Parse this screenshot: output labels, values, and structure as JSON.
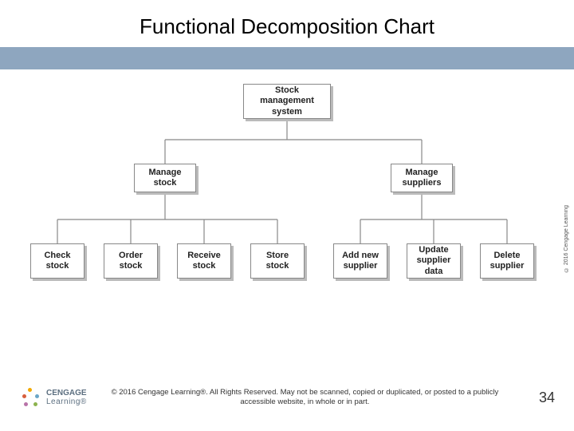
{
  "title": "Functional Decomposition Chart",
  "nodes": {
    "root": "Stock management system",
    "level2": [
      "Manage stock",
      "Manage suppliers"
    ],
    "leaves": [
      "Check stock",
      "Order stock",
      "Receive stock",
      "Store stock",
      "Add new supplier",
      "Update supplier data",
      "Delete supplier"
    ]
  },
  "side_credit": "© 2016 Cengage Learning",
  "logo": {
    "name": "CENGAGE",
    "sub": "Learning®"
  },
  "copyright": "© 2016 Cengage Learning®. All Rights Reserved. May not be scanned, copied or duplicated, or posted to a publicly accessible website, in whole or in part.",
  "page_number": "34",
  "chart_data": {
    "type": "hierarchy",
    "root": {
      "label": "Stock management system",
      "children": [
        {
          "label": "Manage stock",
          "children": [
            {
              "label": "Check stock"
            },
            {
              "label": "Order stock"
            },
            {
              "label": "Receive stock"
            },
            {
              "label": "Store stock"
            }
          ]
        },
        {
          "label": "Manage suppliers",
          "children": [
            {
              "label": "Add new supplier"
            },
            {
              "label": "Update supplier data"
            },
            {
              "label": "Delete supplier"
            }
          ]
        }
      ]
    }
  }
}
